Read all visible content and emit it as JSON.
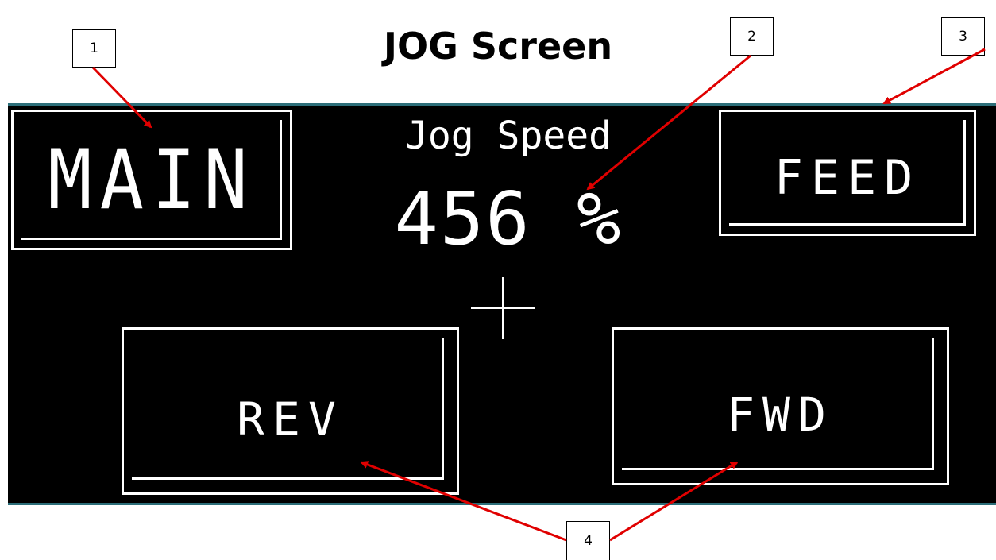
{
  "doc_title": "JOG Screen",
  "callouts": {
    "c1": "1",
    "c2": "2",
    "c3": "3",
    "c4": "4"
  },
  "hmi": {
    "main_button": "MAIN",
    "feed_button": "FEED",
    "jog_speed_label": "Jog Speed",
    "jog_speed_value": "456",
    "jog_speed_unit": "%",
    "rev_button": "REV",
    "fwd_button": "FWD"
  },
  "colors": {
    "panel_bg": "#000000",
    "panel_border": "#2c6e79",
    "arrow": "#e00000"
  }
}
